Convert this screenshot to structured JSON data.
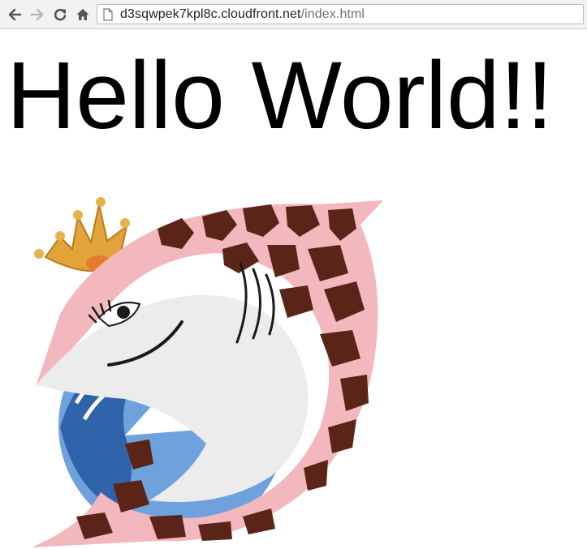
{
  "browser": {
    "url_host": "d3sqwpek7kpl8c.cloudfront.net",
    "url_path": "/index.html",
    "back_icon": "arrow-left",
    "forward_icon": "arrow-right",
    "reload_icon": "reload",
    "home_icon": "home",
    "page_icon": "document"
  },
  "page": {
    "heading": "Hello World!!",
    "logo_colors": {
      "pink": "#f2b8bd",
      "spots": "#5a2418",
      "crown": "#e2a33a",
      "wave_blue": "#3a6fb5",
      "sky_blue": "#6fa2dc"
    }
  }
}
